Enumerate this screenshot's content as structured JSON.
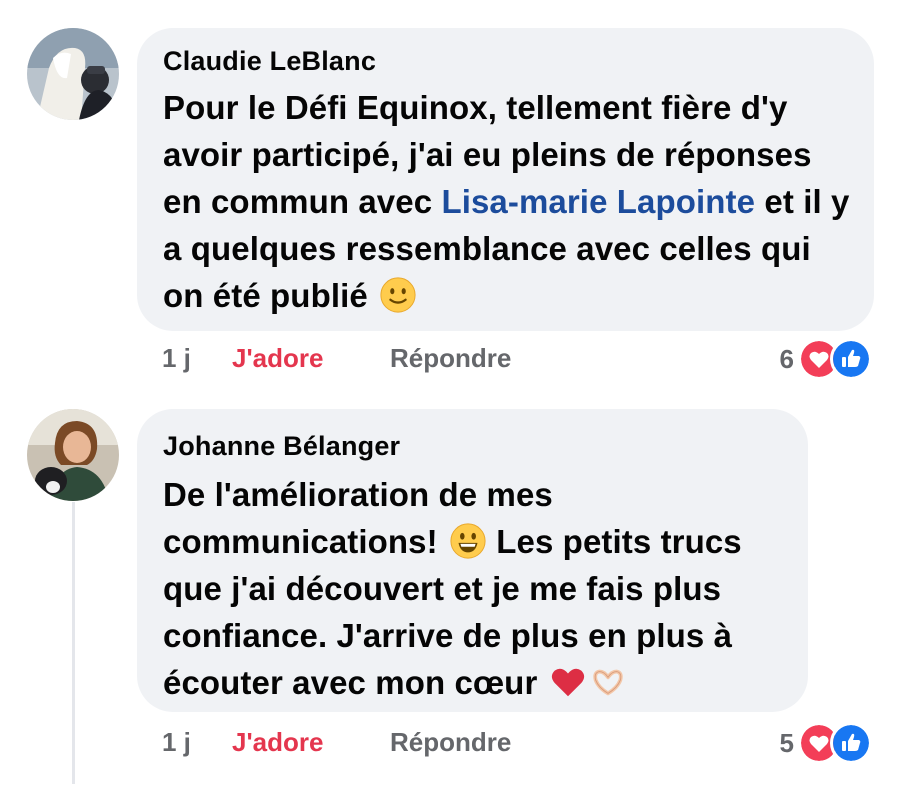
{
  "comments": [
    {
      "author": "Claudie LeBlanc",
      "text_before": "Pour le Défi Equinox, tellement fière d'y avoir participé, j'ai eu pleins de réponses en commun avec ",
      "mention": "Lisa-marie Lapointe",
      "text_after": " et il y a quelques ressemblance avec celles qui on été publié",
      "emojis": [
        "slightly-smiling-face"
      ],
      "time": "1 j",
      "love_label": "J'adore",
      "reply_label": "Répondre",
      "reaction_count": "6",
      "reaction_icons": [
        "love-icon",
        "like-icon"
      ]
    },
    {
      "author": "Johanne Bélanger",
      "text_1": "De l'amélioration de mes communications!",
      "text_2": " Les petits trucs que j'ai découvert et je me fais plus confiance. J'arrive de plus en plus à écouter avec mon cœur",
      "emojis": [
        "grinning-face",
        "red-heart",
        "heart-hands"
      ],
      "time": "1 j",
      "love_label": "J'adore",
      "reply_label": "Répondre",
      "reaction_count": "5",
      "reaction_icons": [
        "love-icon",
        "like-icon"
      ]
    }
  ],
  "colors": {
    "bubble": "#f0f2f5",
    "mention": "#1c4c9c",
    "love": "#e4364e",
    "muted": "#65676b",
    "like_blue": "#1877f2"
  }
}
